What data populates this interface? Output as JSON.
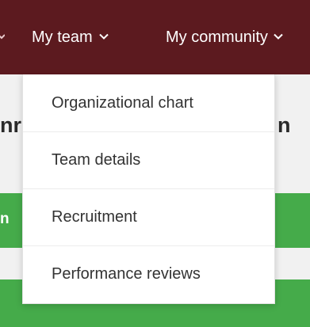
{
  "navbar": {
    "items": [
      {
        "label": "My team",
        "icon": "chevron-down-icon"
      },
      {
        "label": "My community",
        "icon": "chevron-down-icon"
      }
    ],
    "background_color": "#5c1a1f",
    "text_color": "#ffffff"
  },
  "dropdown": {
    "items": [
      {
        "label": "Organizational chart"
      },
      {
        "label": "Team details"
      },
      {
        "label": "Recruitment"
      },
      {
        "label": "Performance reviews"
      }
    ]
  },
  "background": {
    "heading_left": "nr",
    "heading_right": "n",
    "green_bar_text": "n",
    "accent_color": "#45ab4a"
  }
}
